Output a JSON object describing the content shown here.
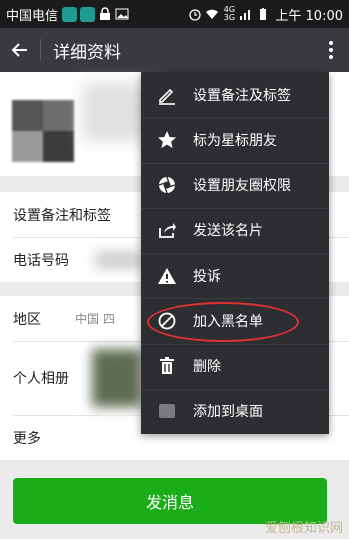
{
  "status_bar": {
    "carrier": "中国电信",
    "net_top": "4G",
    "net_bottom": "3G",
    "time": "上午 10:00"
  },
  "title_bar": {
    "title": "详细资料"
  },
  "rows": {
    "remark": "设置备注和标签",
    "phone": "电话号码",
    "region": "地区",
    "region_value": "中国 四",
    "album": "个人相册",
    "more": "更多"
  },
  "send_button": "发消息",
  "watermark": "爱刨根知识网",
  "menu": {
    "items": [
      {
        "label": "设置备注及标签",
        "icon": "pencil-icon"
      },
      {
        "label": "标为星标朋友",
        "icon": "star-icon"
      },
      {
        "label": "设置朋友圈权限",
        "icon": "camera-aperture-icon"
      },
      {
        "label": "发送该名片",
        "icon": "share-icon"
      },
      {
        "label": "投诉",
        "icon": "warning-icon"
      },
      {
        "label": "加入黑名单",
        "icon": "block-icon"
      },
      {
        "label": "删除",
        "icon": "trash-icon"
      },
      {
        "label": "添加到桌面",
        "icon": "desktop-icon"
      }
    ],
    "highlighted_item": "加入黑名单",
    "highlight_color": "#e03030"
  },
  "colors": {
    "title_bar": "#393a3f",
    "menu_bg": "#2d2e32",
    "send_button": "#1aad19"
  }
}
